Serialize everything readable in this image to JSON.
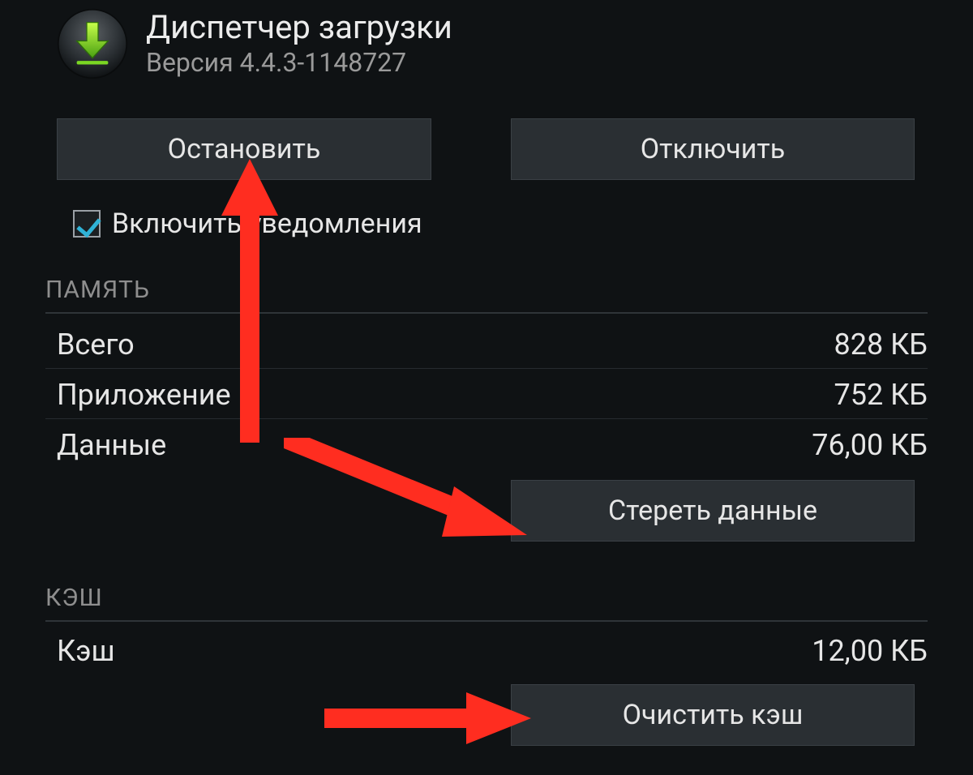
{
  "app": {
    "title": "Диспетчер загрузки",
    "version": "Версия 4.4.3-1148727"
  },
  "buttons": {
    "stop": "Остановить",
    "disable": "Отключить",
    "clear_data": "Стереть данные",
    "clear_cache": "Очистить кэш"
  },
  "checkbox": {
    "notifications_label": "Включить уведомления",
    "notifications_checked": true
  },
  "sections": {
    "memory": "ПАМЯТЬ",
    "cache": "КЭШ"
  },
  "memory": {
    "total_label": "Всего",
    "total_value": "828 КБ",
    "app_label": "Приложение",
    "app_value": "752 КБ",
    "data_label": "Данные",
    "data_value": "76,00 КБ"
  },
  "cache": {
    "label": "Кэш",
    "value": "12,00 КБ"
  },
  "annotations": {
    "arrow_color": "#ff2d20"
  }
}
